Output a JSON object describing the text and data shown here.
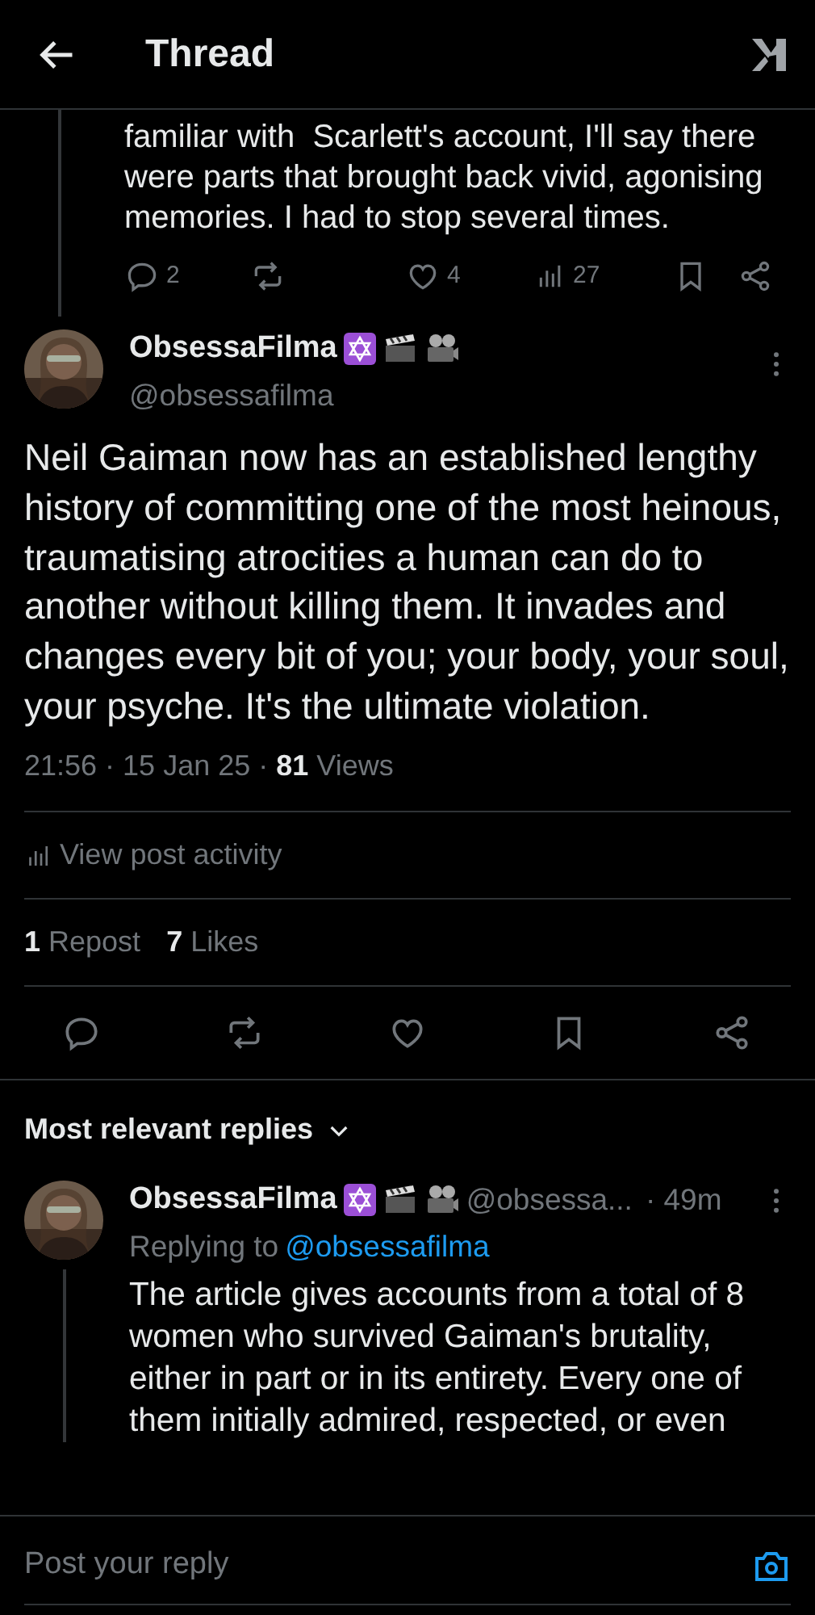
{
  "header": {
    "title": "Thread"
  },
  "parent_post": {
    "text": "familiar with  Scarlett's account, I'll say there were parts that brought back vivid, agonising memories. I had to stop several times.",
    "replies": "2",
    "likes": "4",
    "views": "27"
  },
  "main_post": {
    "name": "ObsessaFilma",
    "handle": "@obsessafilma",
    "text": "Neil Gaiman now has an established lengthy history of committing one of the most heinous, traumatising atrocities a human can do to another without killing them. It invades and changes every bit of you; your body, your soul, your psyche. It's the ultimate violation.",
    "meta": "21:56 · 15 Jan 25 · **81** Views",
    "activity": "View post activity",
    "reposts": "**1** Repost",
    "likes": "**7** Likes"
  },
  "replies_header": {
    "label": "Most relevant replies",
    "expanded": false
  },
  "reply": {
    "name": "ObsessaFilma",
    "handle": "@obsessa...",
    "time": "· 49m",
    "replying_prefix": "Replying to",
    "replying_handle": "@obsessafilma",
    "text": "The article gives accounts from a total of 8 women who survived Gaiman's brutality, either in part or in its entirety. Every one of them initially admired, respected, or even"
  },
  "composer": {
    "placeholder": "Post your reply"
  }
}
